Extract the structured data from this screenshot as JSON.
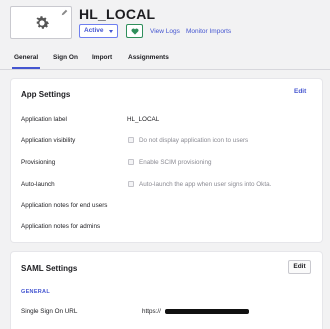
{
  "app": {
    "title": "HL_LOCAL",
    "logo_icon": "gear-icon",
    "status": "Active",
    "push_icon": "heart-icon",
    "links": [
      "View Logs",
      "Monitor Imports"
    ]
  },
  "tabs": [
    {
      "label": "General",
      "active": true
    },
    {
      "label": "Sign On",
      "active": false
    },
    {
      "label": "Import",
      "active": false
    },
    {
      "label": "Assignments",
      "active": false
    }
  ],
  "app_settings": {
    "title": "App Settings",
    "edit_label": "Edit",
    "rows": [
      {
        "label": "Application label",
        "value": "HL_LOCAL"
      },
      {
        "label": "Application visibility",
        "value": "Do not display application icon to users",
        "checkbox": true
      },
      {
        "label": "Provisioning",
        "value": "Enable SCIM provisioning",
        "checkbox": true
      },
      {
        "label": "Auto-launch",
        "value": "Auto-launch the app when user signs into Okta.",
        "checkbox": true
      },
      {
        "label": "Application notes for end users",
        "value": ""
      },
      {
        "label": "Application notes for admins",
        "value": ""
      }
    ]
  },
  "saml_settings": {
    "title": "SAML Settings",
    "edit_label": "Edit",
    "section": "GENERAL",
    "rows": [
      {
        "label": "Single Sign On URL",
        "value": "https://"
      }
    ]
  },
  "colors": {
    "accent": "#4455d0",
    "success": "#2f8f5b",
    "background": "#f2f2f3"
  }
}
